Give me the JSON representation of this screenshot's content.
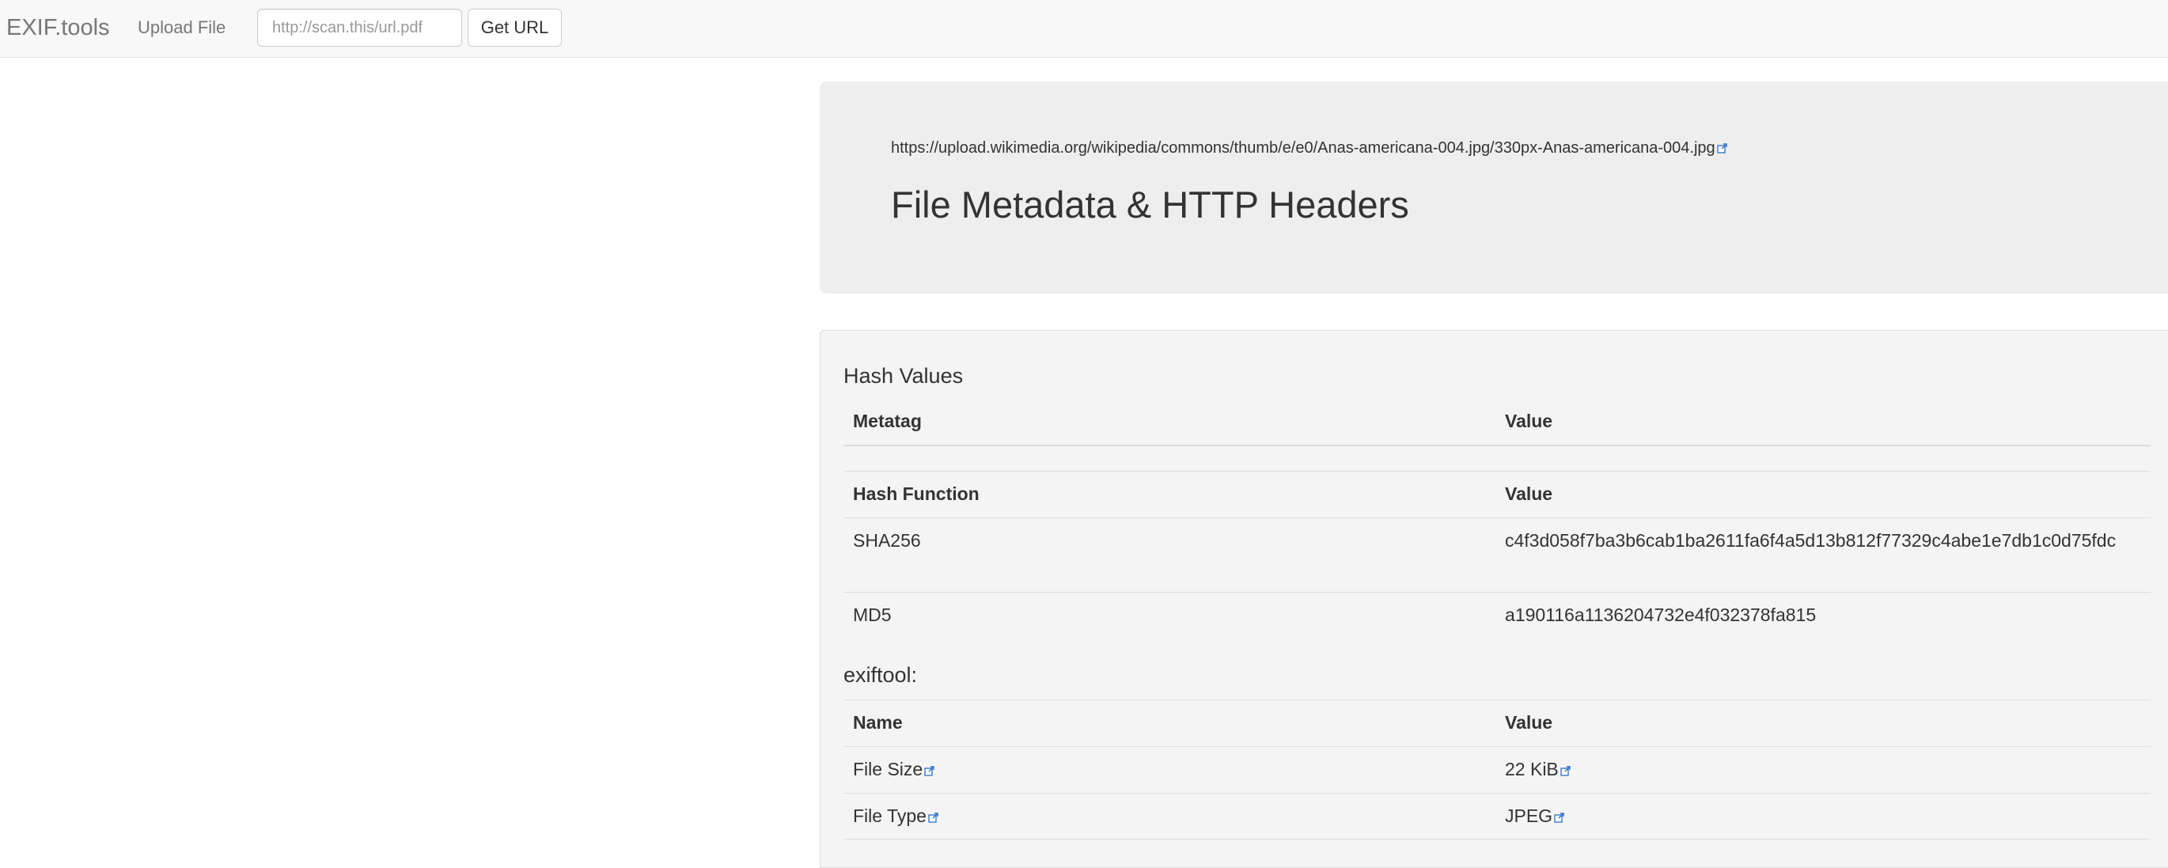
{
  "navbar": {
    "brand": "EXIF.tools",
    "upload_label": "Upload File",
    "url_placeholder": "http://scan.this/url.pdf",
    "url_value": "",
    "get_url_label": "Get URL"
  },
  "jumbotron": {
    "source_url": "https://upload.wikimedia.org/wikipedia/commons/thumb/e/e0/Anas-americana-004.jpg/330px-Anas-americana-004.jpg",
    "title": "File Metadata & HTTP Headers"
  },
  "hash_section": {
    "heading": "Hash Values",
    "header": {
      "metatag": "Metatag",
      "value": "Value"
    },
    "subheader": {
      "hash_function": "Hash Function",
      "value": "Value"
    },
    "rows": [
      {
        "name": "SHA256",
        "value": "c4f3d058f7ba3b6cab1ba2611fa6f4a5d13b812f77329c4abe1e7db1c0d75fdc"
      },
      {
        "name": "MD5",
        "value": "a190116a1136204732e4f032378fa815"
      }
    ]
  },
  "exif_section": {
    "heading": "exiftool:",
    "header": {
      "name": "Name",
      "value": "Value"
    },
    "rows": [
      {
        "name": "File Size",
        "value": "22 KiB"
      },
      {
        "name": "File Type",
        "value": "JPEG"
      }
    ]
  },
  "colors": {
    "navbar_bg": "#f8f8f8",
    "jumbotron_bg": "#eeeeee",
    "panel_bg": "#f4f4f4",
    "link_icon": "#2a6fc9"
  },
  "icons": {
    "external_link": "external-link-icon"
  }
}
